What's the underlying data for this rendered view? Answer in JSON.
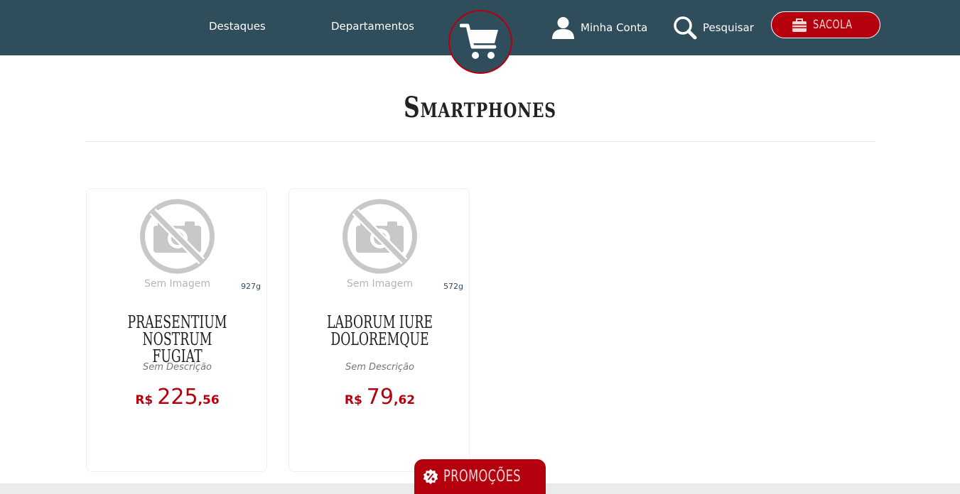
{
  "colors": {
    "header": "#2f4d5b",
    "accent": "#b5000d"
  },
  "header": {
    "nav": {
      "destaques": "Destaques",
      "departamentos": "Departamentos"
    },
    "account_label": "Minha Conta",
    "search_label": "Pesquisar",
    "bag_label": "SACOLA",
    "logo_icon": "shopping-cart-icon"
  },
  "category": {
    "title": "Smartphones"
  },
  "products": [
    {
      "image_alt": "Sem Imagem",
      "weight": "927g",
      "name": "Praesentium nostrum fugiat",
      "description": "Sem Descrição",
      "price": {
        "currency": "R$",
        "integer": "225",
        "decimal": ",56"
      }
    },
    {
      "image_alt": "Sem Imagem",
      "weight": "572g",
      "name": "Laborum iure doloremque",
      "description": "Sem Descrição",
      "price": {
        "currency": "R$",
        "integer": "79",
        "decimal": ",62"
      }
    }
  ],
  "footer": {
    "promo_label": "PROMOÇÕES",
    "promo_icon": "percent-badge-icon"
  }
}
